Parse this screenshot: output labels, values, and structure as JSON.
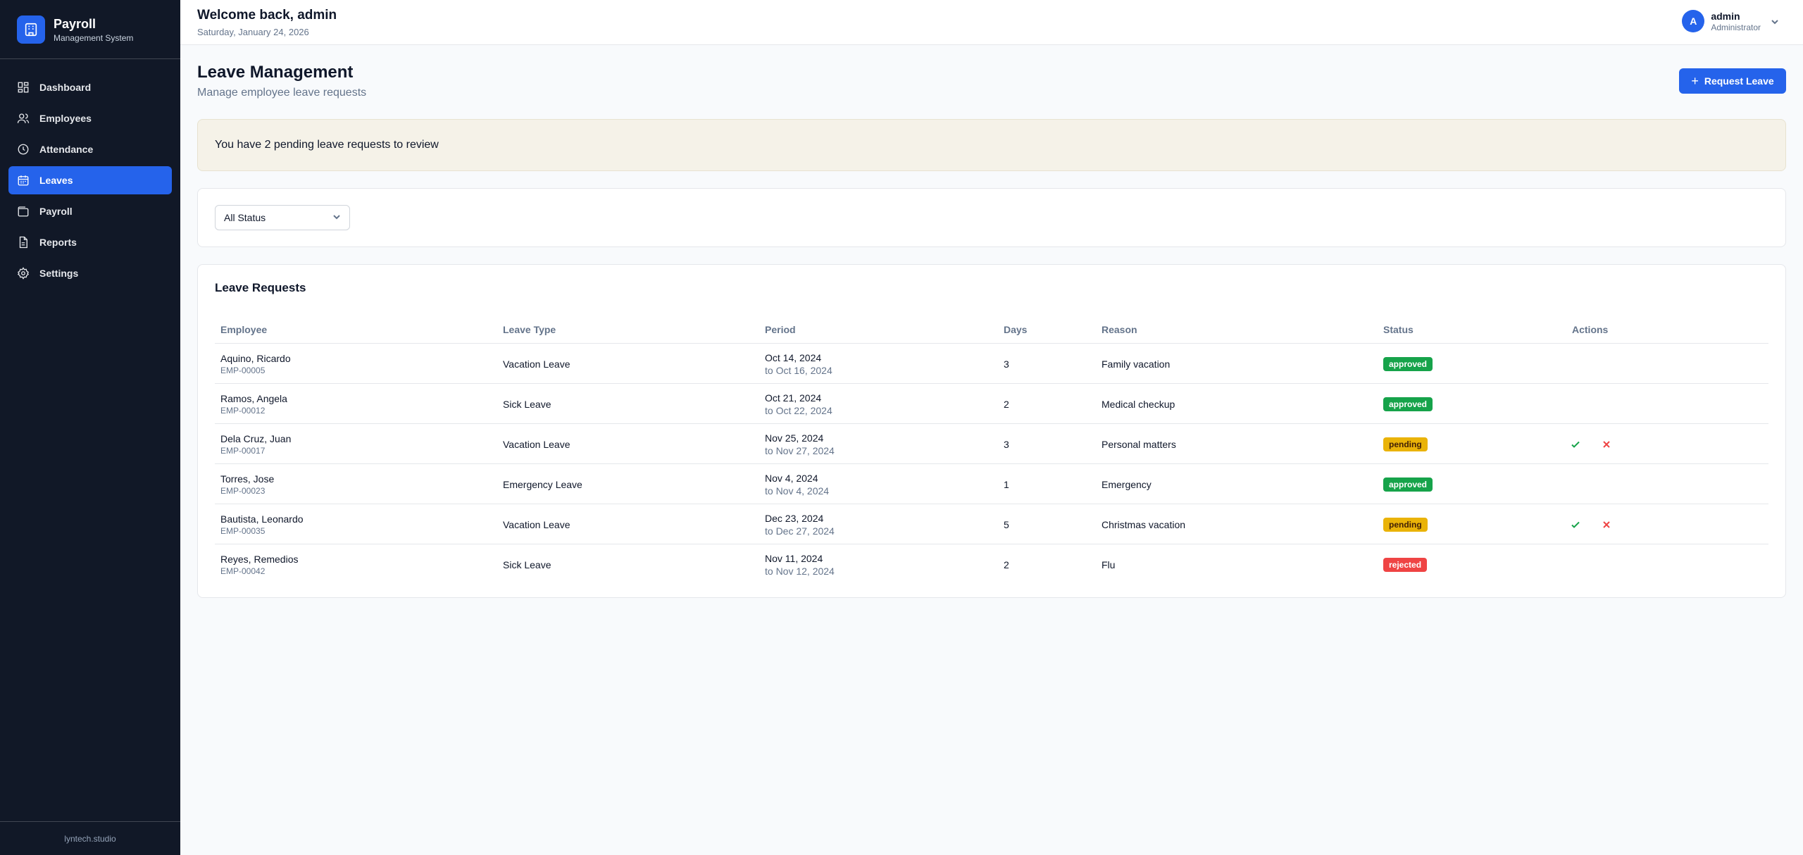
{
  "brand": {
    "title": "Payroll",
    "subtitle": "Management System"
  },
  "sidebar": {
    "items": [
      {
        "label": "Dashboard",
        "icon": "dashboard-icon",
        "active": false
      },
      {
        "label": "Employees",
        "icon": "users-icon",
        "active": false
      },
      {
        "label": "Attendance",
        "icon": "clock-icon",
        "active": false
      },
      {
        "label": "Leaves",
        "icon": "calendar-icon",
        "active": true
      },
      {
        "label": "Payroll",
        "icon": "wallet-icon",
        "active": false
      },
      {
        "label": "Reports",
        "icon": "document-icon",
        "active": false
      },
      {
        "label": "Settings",
        "icon": "gear-icon",
        "active": false
      }
    ],
    "footer": "lyntech.studio"
  },
  "header": {
    "welcome": "Welcome back, admin",
    "date": "Saturday, January 24, 2026",
    "user": {
      "initial": "A",
      "name": "admin",
      "role": "Administrator"
    }
  },
  "page": {
    "title": "Leave Management",
    "subtitle": "Manage employee leave requests",
    "request_button": "Request Leave"
  },
  "alert": {
    "text": "You have 2 pending leave requests to review"
  },
  "filter": {
    "selected": "All Status"
  },
  "table": {
    "title": "Leave Requests",
    "columns": [
      "Employee",
      "Leave Type",
      "Period",
      "Days",
      "Reason",
      "Status",
      "Actions"
    ],
    "rows": [
      {
        "name": "Aquino, Ricardo",
        "id": "EMP-00005",
        "type": "Vacation Leave",
        "from": "Oct 14, 2024",
        "to": "to Oct 16, 2024",
        "days": "3",
        "reason": "Family vacation",
        "status": "approved"
      },
      {
        "name": "Ramos, Angela",
        "id": "EMP-00012",
        "type": "Sick Leave",
        "from": "Oct 21, 2024",
        "to": "to Oct 22, 2024",
        "days": "2",
        "reason": "Medical checkup",
        "status": "approved"
      },
      {
        "name": "Dela Cruz, Juan",
        "id": "EMP-00017",
        "type": "Vacation Leave",
        "from": "Nov 25, 2024",
        "to": "to Nov 27, 2024",
        "days": "3",
        "reason": "Personal matters",
        "status": "pending"
      },
      {
        "name": "Torres, Jose",
        "id": "EMP-00023",
        "type": "Emergency Leave",
        "from": "Nov 4, 2024",
        "to": "to Nov 4, 2024",
        "days": "1",
        "reason": "Emergency",
        "status": "approved"
      },
      {
        "name": "Bautista, Leonardo",
        "id": "EMP-00035",
        "type": "Vacation Leave",
        "from": "Dec 23, 2024",
        "to": "to Dec 27, 2024",
        "days": "5",
        "reason": "Christmas vacation",
        "status": "pending"
      },
      {
        "name": "Reyes, Remedios",
        "id": "EMP-00042",
        "type": "Sick Leave",
        "from": "Nov 11, 2024",
        "to": "to Nov 12, 2024",
        "days": "2",
        "reason": "Flu",
        "status": "rejected"
      }
    ]
  },
  "colors": {
    "sidebar_bg": "#111827",
    "accent": "#2563eb",
    "approved": "#16a34a",
    "pending": "#eab308",
    "rejected": "#ef4444",
    "approve_icon": "#16a34a",
    "reject_icon": "#ef4444"
  }
}
